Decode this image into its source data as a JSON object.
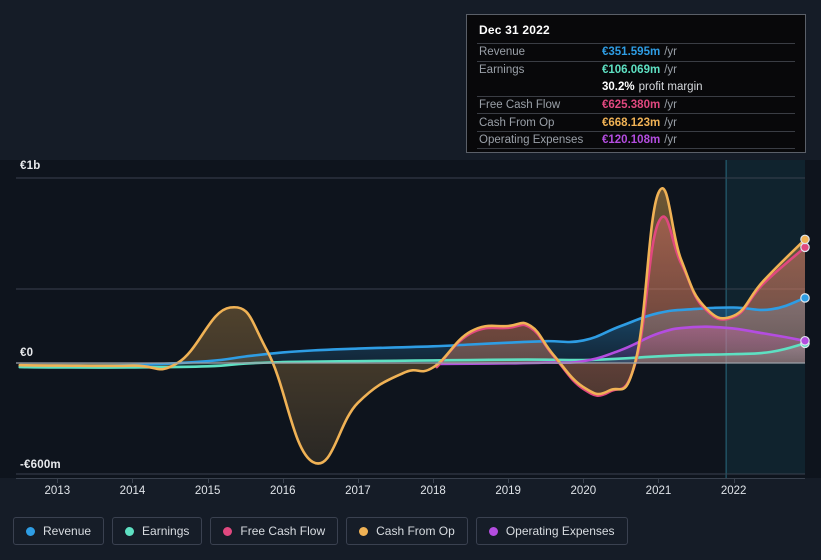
{
  "chart_data": {
    "type": "area",
    "title": "",
    "xlabel": "",
    "ylabel": "",
    "currency": "EUR",
    "grid": true,
    "legend_position": "bottom-left",
    "xlim": [
      2012.45,
      2022.95
    ],
    "ylim": [
      -600,
      1000
    ],
    "y_ticks": [
      {
        "value": 1000,
        "label": "€1b"
      },
      {
        "value": 0,
        "label": "€0"
      },
      {
        "value": -600,
        "label": "-€600m"
      }
    ],
    "x_ticks": [
      "2013",
      "2014",
      "2015",
      "2016",
      "2017",
      "2018",
      "2019",
      "2020",
      "2021",
      "2022"
    ],
    "units": "millions EUR per year",
    "highlight_band": {
      "from": 2021.9,
      "to": 2022.95
    },
    "series": [
      {
        "name": "Revenue",
        "color": "#2e9de4",
        "end_value": 351.595,
        "x": [
          2012.5,
          2013,
          2014,
          2015,
          2015.5,
          2016,
          2016.5,
          2017,
          2017.5,
          2018,
          2018.5,
          2019,
          2019.5,
          2020,
          2020.5,
          2021,
          2021.5,
          2022,
          2022.5,
          2022.95
        ],
        "values": [
          -14,
          -14,
          -11,
          10,
          35,
          57,
          70,
          78,
          84,
          90,
          100,
          110,
          118,
          122,
          200,
          270,
          292,
          300,
          290,
          351.595
        ]
      },
      {
        "name": "Earnings",
        "color": "#5ee0c2",
        "end_value": 106.069,
        "x": [
          2012.5,
          2013,
          2014,
          2015,
          2015.5,
          2016,
          2016.5,
          2017,
          2017.5,
          2018,
          2018.5,
          2019,
          2019.5,
          2020,
          2020.5,
          2021,
          2021.5,
          2022,
          2022.5,
          2022.95
        ],
        "values": [
          -22,
          -24,
          -24,
          -18,
          -3,
          5,
          8,
          10,
          12,
          14,
          16,
          18,
          18,
          16,
          24,
          36,
          44,
          48,
          60,
          106.069
        ]
      },
      {
        "name": "Free Cash Flow",
        "color": "#e0487f",
        "end_value": 625.38,
        "x": [
          2018.05,
          2018.5,
          2019,
          2019.3,
          2019.6,
          2020,
          2020.35,
          2020.7,
          2021,
          2021.3,
          2021.6,
          2022,
          2022.4,
          2022.95
        ],
        "values": [
          -22,
          160,
          190,
          190,
          40,
          -140,
          -155,
          10,
          760,
          540,
          300,
          248,
          430,
          625.38
        ]
      },
      {
        "name": "Cash From Op",
        "color": "#f0b255",
        "end_value": 668.123,
        "x": [
          2012.5,
          2013,
          2014,
          2014.6,
          2015.3,
          2015.8,
          2016.4,
          2017,
          2017.6,
          2018,
          2018.5,
          2019,
          2019.3,
          2019.6,
          2020,
          2020.35,
          2020.7,
          2021,
          2021.3,
          2021.6,
          2022,
          2022.4,
          2022.95
        ],
        "values": [
          -12,
          -14,
          -14,
          0,
          300,
          60,
          -535,
          -215,
          -55,
          -24,
          170,
          200,
          200,
          45,
          -130,
          -148,
          20,
          920,
          560,
          310,
          255,
          445,
          668.123
        ]
      },
      {
        "name": "Operating Expenses",
        "color": "#b44de0",
        "end_value": 120.108,
        "x": [
          2018.05,
          2018.5,
          2019,
          2019.5,
          2020,
          2020.5,
          2021,
          2021.4,
          2021.9,
          2022.4,
          2022.95
        ],
        "values": [
          -5,
          -4,
          -2,
          2,
          10,
          70,
          160,
          192,
          190,
          160,
          120.108
        ]
      }
    ]
  },
  "tooltip": {
    "date": "Dec 31 2022",
    "rows": [
      {
        "label": "Revenue",
        "value": "€351.595m",
        "unit": "/yr",
        "color": "#2e9de4"
      },
      {
        "label": "Earnings",
        "value": "€106.069m",
        "unit": "/yr",
        "color": "#5ee0c2"
      },
      {
        "label": "Free Cash Flow",
        "value": "€625.380m",
        "unit": "/yr",
        "color": "#e0487f"
      },
      {
        "label": "Cash From Op",
        "value": "€668.123m",
        "unit": "/yr",
        "color": "#f0b255"
      },
      {
        "label": "Operating Expenses",
        "value": "€120.108m",
        "unit": "/yr",
        "color": "#b44de0"
      }
    ],
    "profit_margin_value": "30.2%",
    "profit_margin_label": "profit margin"
  },
  "legend": {
    "items": [
      {
        "label": "Revenue",
        "color": "#2e9de4"
      },
      {
        "label": "Earnings",
        "color": "#5ee0c2"
      },
      {
        "label": "Free Cash Flow",
        "color": "#e0487f"
      },
      {
        "label": "Cash From Op",
        "color": "#f0b255"
      },
      {
        "label": "Operating Expenses",
        "color": "#b44de0"
      }
    ]
  }
}
